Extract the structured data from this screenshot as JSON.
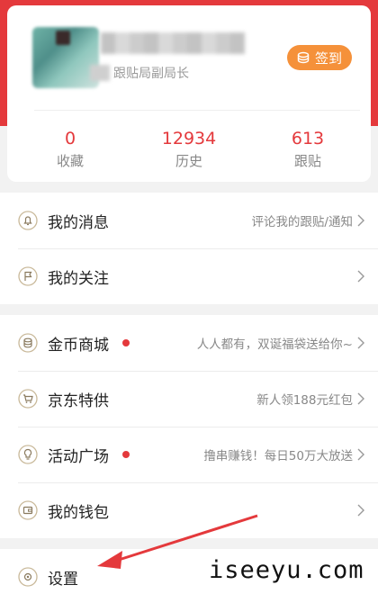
{
  "profile": {
    "level": "跟贴局副局长",
    "checkin_label": "签到",
    "stats": [
      {
        "value": "0",
        "label": "收藏"
      },
      {
        "value": "12934",
        "label": "历史"
      },
      {
        "value": "613",
        "label": "跟贴"
      }
    ]
  },
  "menu_group_1": [
    {
      "title": "我的消息",
      "desc": "评论我的跟贴/通知",
      "icon": "bell-icon"
    },
    {
      "title": "我的关注",
      "desc": "",
      "icon": "flag-icon"
    }
  ],
  "menu_group_2": [
    {
      "title": "金币商城",
      "desc": "人人都有，双诞福袋送给你~",
      "icon": "coin-stack-icon",
      "badge": true
    },
    {
      "title": "京东特供",
      "desc": "新人领188元红包",
      "icon": "cart-icon"
    },
    {
      "title": "活动广场",
      "desc": "撸串赚钱！每日50万大放送",
      "icon": "bulb-icon",
      "badge": true
    },
    {
      "title": "我的钱包",
      "desc": "",
      "icon": "wallet-icon"
    }
  ],
  "menu_group_3": [
    {
      "title": "设置",
      "icon": "gear-icon"
    }
  ],
  "watermark": "iseeyu.com",
  "colors": {
    "accent": "#e4393c",
    "checkin": "#f5913a"
  }
}
